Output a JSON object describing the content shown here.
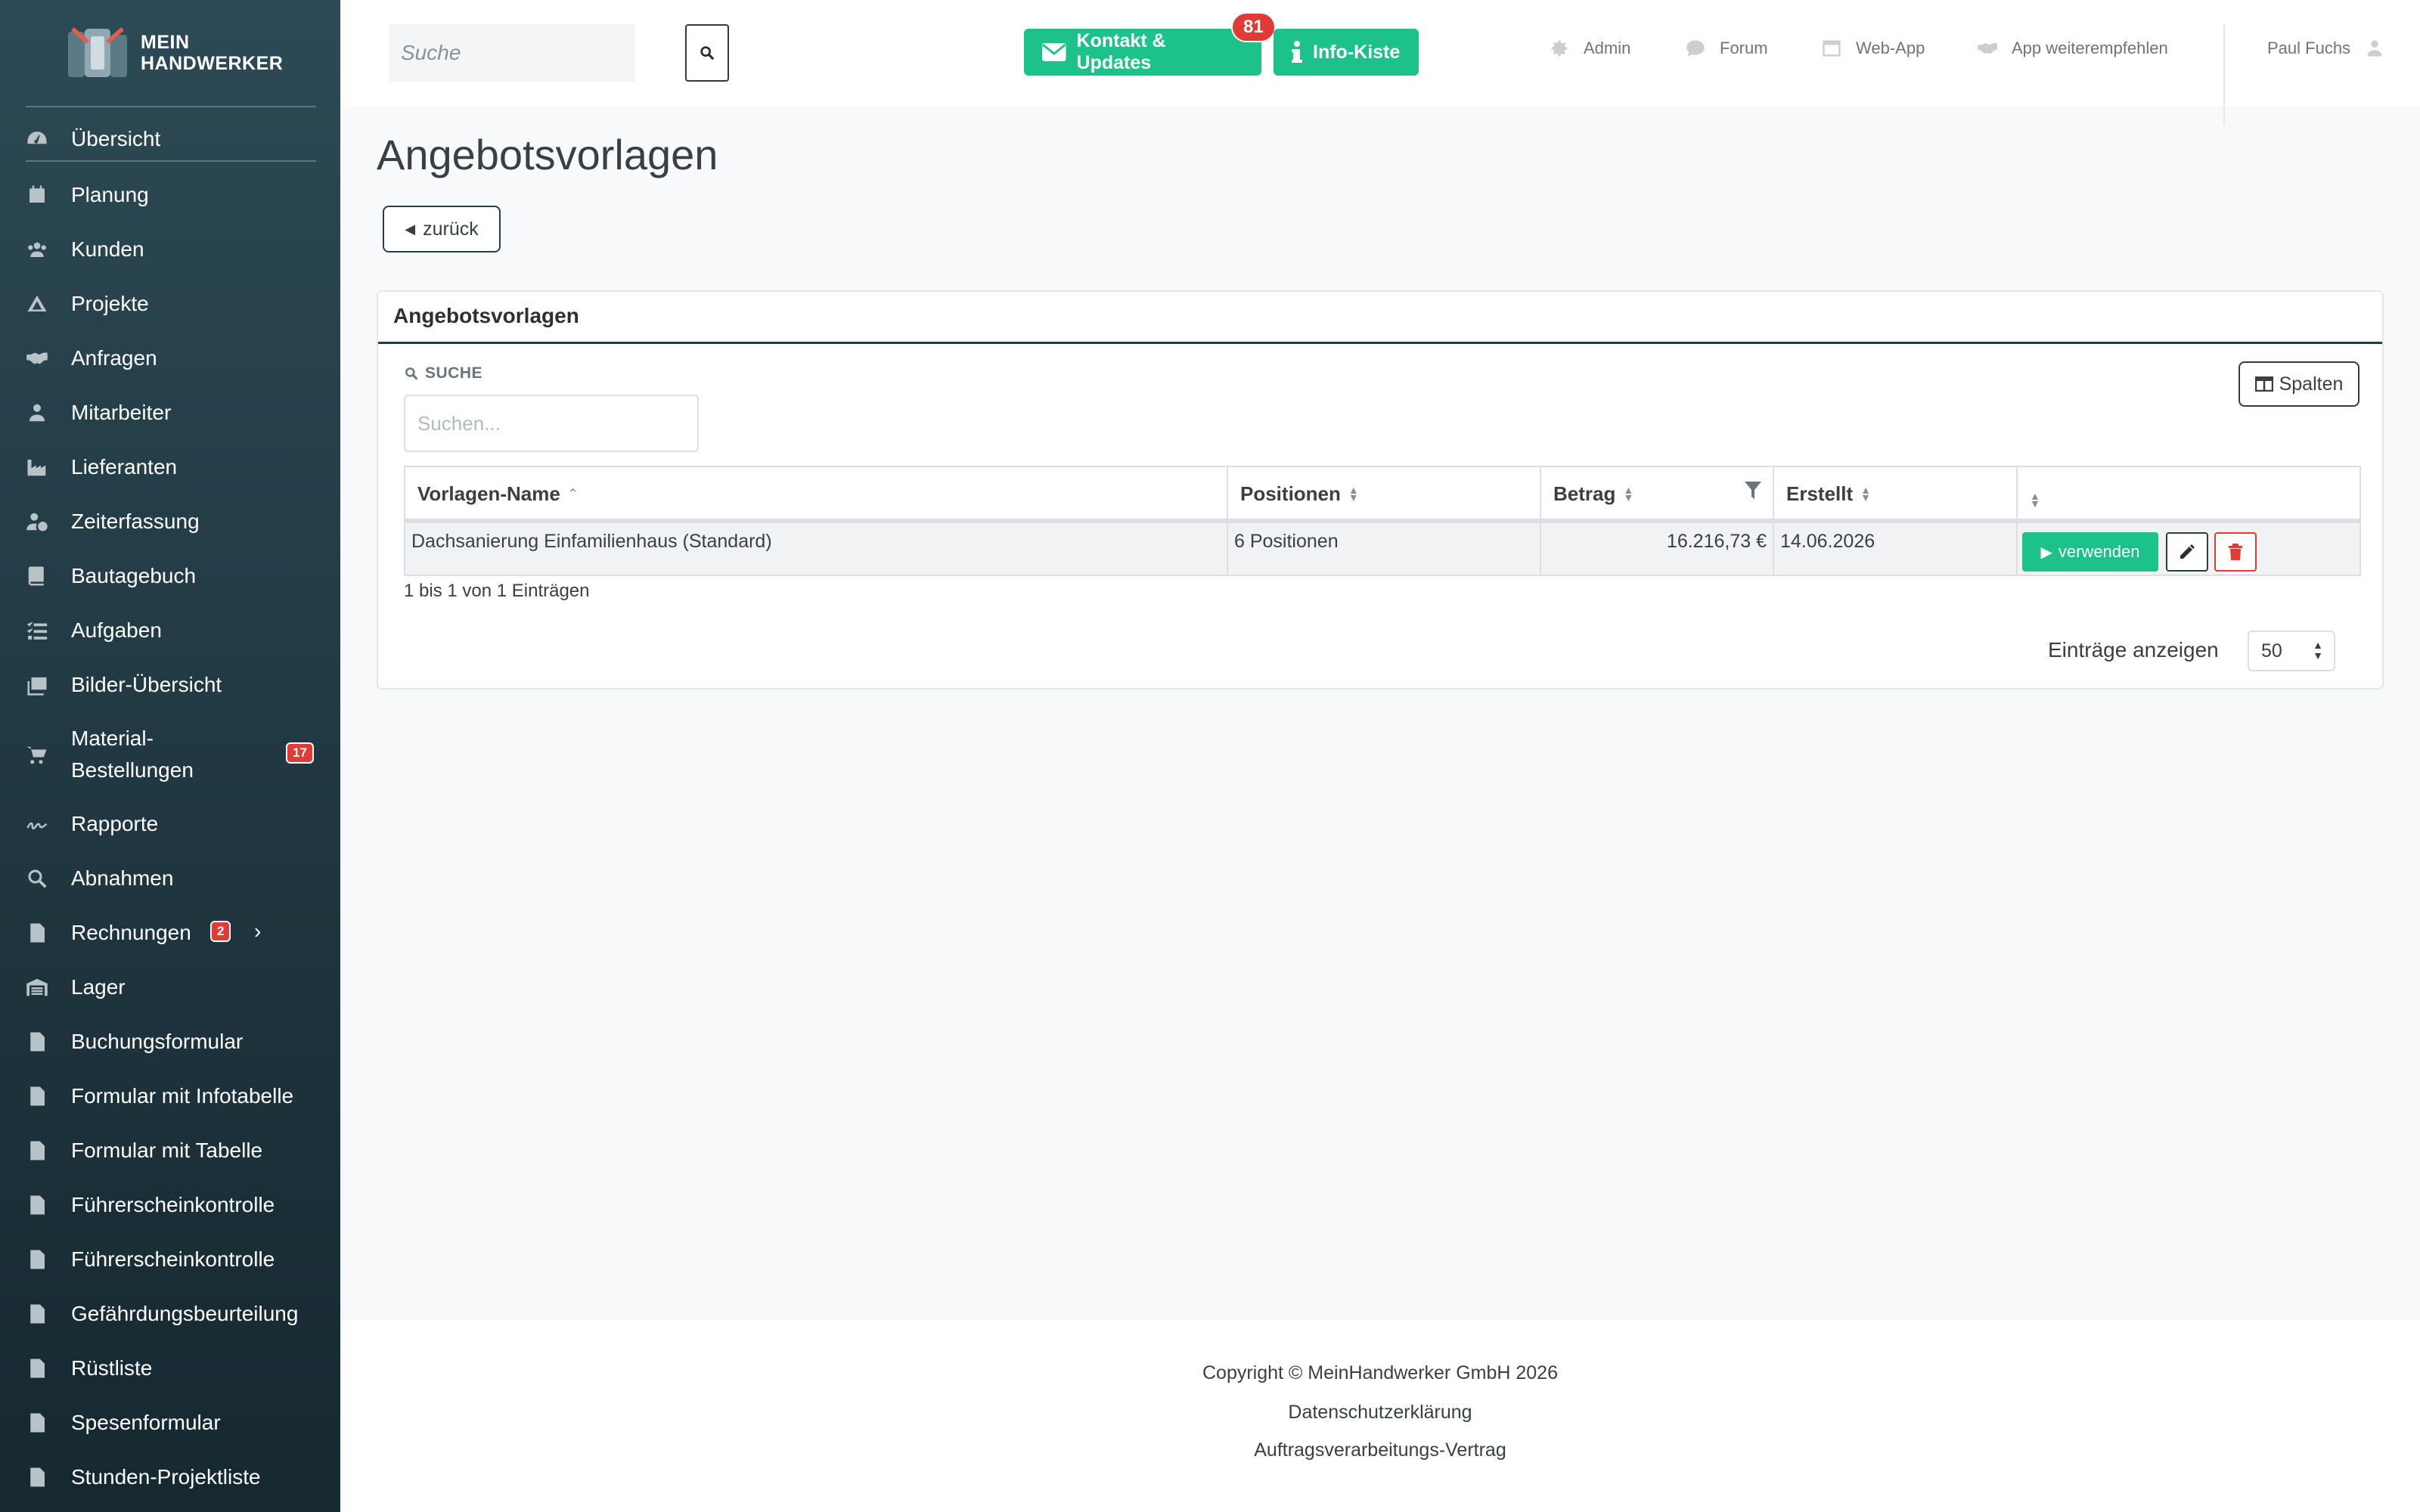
{
  "app": {
    "logo_line1": "MEIN",
    "logo_line2": "HANDWERKER"
  },
  "sidebar": {
    "items": [
      {
        "label": "Übersicht",
        "icon": "dashboard-icon"
      },
      {
        "label": "Planung",
        "icon": "calendar-icon"
      },
      {
        "label": "Kunden",
        "icon": "users-icon"
      },
      {
        "label": "Projekte",
        "icon": "projects-icon"
      },
      {
        "label": "Anfragen",
        "icon": "handshake-icon"
      },
      {
        "label": "Mitarbeiter",
        "icon": "user-icon"
      },
      {
        "label": "Lieferanten",
        "icon": "industry-icon"
      },
      {
        "label": "Zeiterfassung",
        "icon": "user-clock-icon"
      },
      {
        "label": "Bautagebuch",
        "icon": "book-icon"
      },
      {
        "label": "Aufgaben",
        "icon": "tasks-icon"
      },
      {
        "label": "Bilder-Übersicht",
        "icon": "images-icon"
      },
      {
        "label": "Material-",
        "label2": "Bestellungen",
        "icon": "cart-icon",
        "badge": "17"
      },
      {
        "label": "Rapporte",
        "icon": "signature-icon"
      },
      {
        "label": "Abnahmen",
        "icon": "search-icon"
      },
      {
        "label": "Rechnungen",
        "icon": "invoice-icon",
        "badge": "2"
      },
      {
        "label": "Lager",
        "icon": "warehouse-icon"
      },
      {
        "label": "Buchungsformular",
        "icon": "document-icon"
      },
      {
        "label": "Formular mit Infotabelle",
        "icon": "document-icon"
      },
      {
        "label": "Formular mit Tabelle",
        "icon": "document-icon"
      },
      {
        "label": "Führerscheinkontrolle",
        "icon": "document-icon"
      },
      {
        "label": "Führerscheinkontrolle",
        "icon": "document-icon"
      },
      {
        "label": "Gefährdungsbeurteilung",
        "icon": "document-icon"
      },
      {
        "label": "Rüstliste",
        "icon": "document-icon"
      },
      {
        "label": "Spesenformular",
        "icon": "document-icon"
      },
      {
        "label": "Stunden-Projektliste",
        "icon": "document-icon"
      }
    ]
  },
  "topbar": {
    "search_placeholder": "Suche",
    "contact_label": "Kontakt & Updates",
    "contact_badge": "81",
    "info_label": "Info-Kiste",
    "links": {
      "admin": "Admin",
      "forum": "Forum",
      "webapp": "Web-App",
      "recommend": "App weiterempfehlen"
    },
    "user_name": "Paul Fuchs"
  },
  "page": {
    "title": "Angebotsvorlagen",
    "back_label": "zurück"
  },
  "card": {
    "title": "Angebotsvorlagen",
    "search_label": "SUCHE",
    "search_placeholder": "Suchen...",
    "columns_button": "Spalten",
    "headers": {
      "name": "Vorlagen-Name",
      "positions": "Positionen",
      "amount": "Betrag",
      "created": "Erstellt"
    },
    "rows": [
      {
        "name": "Dachsanierung Einfamilienhaus (Standard)",
        "positions": "6 Positionen",
        "amount": "16.216,73 €",
        "created": "14.06.2026",
        "use_label": "verwenden"
      }
    ],
    "info": "1 bis 1 von 1 Einträgen",
    "length_label": "Einträge anzeigen",
    "length_value": "50"
  },
  "footer": {
    "copyright": "Copyright © MeinHandwerker GmbH 2026",
    "privacy": "Datenschutzerklärung",
    "contract": "Auftragsverarbeitungs-Vertrag"
  },
  "colors": {
    "accent_green": "#1cc28a",
    "badge_red": "#e03b35",
    "sidebar_top": "#2c4a55",
    "sidebar_bottom": "#162830"
  }
}
